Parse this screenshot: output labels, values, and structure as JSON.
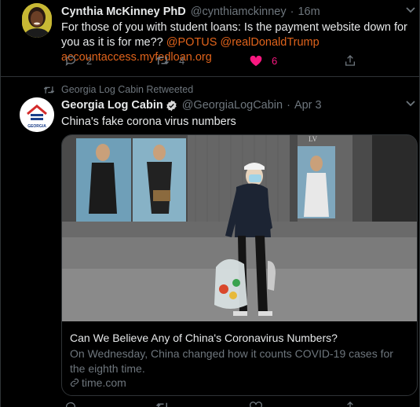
{
  "tweets": [
    {
      "author_name": "Cynthia McKinney PhD",
      "author_handle": "@cynthiamckinney",
      "separator": "·",
      "time": "16m",
      "text_plain": "For those of you with student loans: Is the payment website down for you as it is for me?? ",
      "mentions": [
        "@POTUS",
        "@realDonaldTrump"
      ],
      "link": "accountaccess.myfedloan.org",
      "replies": "2",
      "retweets": "4",
      "likes": "6",
      "liked": true
    },
    {
      "retweeted_by": "Georgia Log Cabin Retweeted",
      "author_name": "Georgia Log Cabin",
      "verified": true,
      "author_handle": "@GeorgiaLogCabin",
      "separator": "·",
      "time": "Apr 3",
      "text": "China's fake corona virus numbers",
      "avatar_label": "GEORGIA",
      "card": {
        "title": "Can We Believe Any of China's Coronavirus Numbers?",
        "description": "On Wednesday, China changed how it counts COVID-19 cases for the eighth time.",
        "domain": "time.com",
        "storefront_logo": "LV"
      }
    }
  ],
  "icons": {
    "reply": "reply-icon",
    "retweet": "retweet-icon",
    "like": "heart-icon",
    "share": "share-icon",
    "caret": "chevron-down-icon",
    "verified": "verified-badge-icon",
    "link": "link-icon"
  },
  "colors": {
    "background": "#000000",
    "mention": "#e0631b",
    "like": "#f91880",
    "muted": "#6e767d",
    "verified_badge": "#d9d9d9",
    "divider": "#2f3336"
  }
}
